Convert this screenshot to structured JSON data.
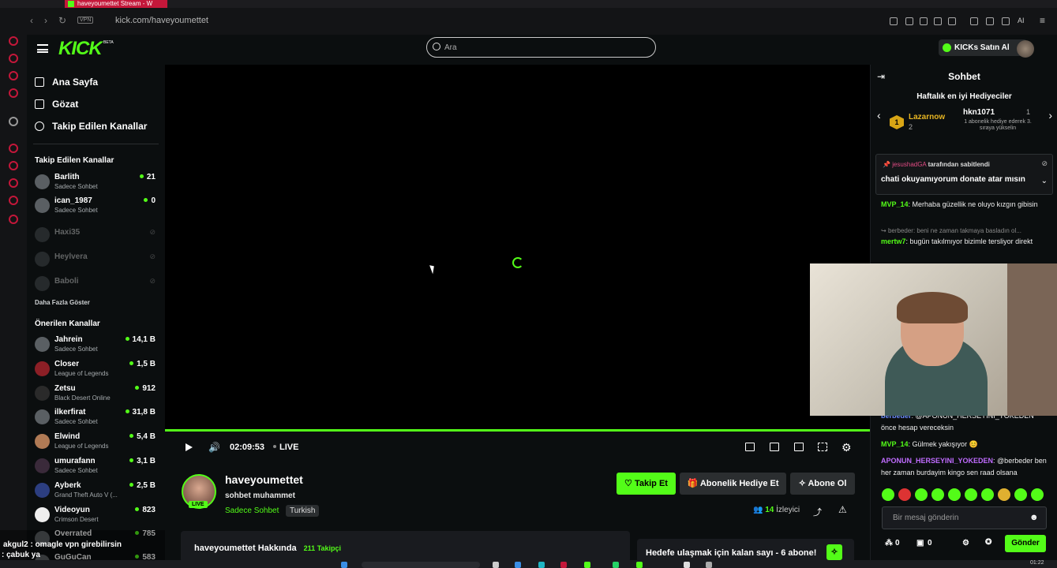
{
  "browser": {
    "tab_title": "haveyoumettet Stream - W",
    "url": "kick.com/haveyoumettet",
    "vpn_label": "VPN",
    "ai_label": "AI"
  },
  "header": {
    "logo": "KICK",
    "logo_beta": "BETA",
    "search_placeholder": "Ara",
    "buy_kicks": "KICKs Satın Al"
  },
  "sidebar": {
    "nav": [
      {
        "label": "Ana Sayfa",
        "icon": "home-icon"
      },
      {
        "label": "Gözat",
        "icon": "browse-icon"
      },
      {
        "label": "Takip Edilen Kanallar",
        "icon": "heart-icon"
      }
    ],
    "followed_title": "Takip Edilen Kanallar",
    "followed": [
      {
        "name": "Barlith",
        "sub": "Sadece Sohbet",
        "count": "21",
        "live": true
      },
      {
        "name": "ican_1987",
        "sub": "Sadece Sohbet",
        "count": "0",
        "live": true
      },
      {
        "name": "Haxi35",
        "sub": "",
        "count": "",
        "live": false
      },
      {
        "name": "Heylvera",
        "sub": "",
        "count": "",
        "live": false
      },
      {
        "name": "Baboli",
        "sub": "",
        "count": "",
        "live": false
      }
    ],
    "show_more": "Daha Fazla Göster",
    "recommended_title": "Önerilen Kanallar",
    "recommended": [
      {
        "name": "Jahrein",
        "sub": "Sadece Sohbet",
        "count": "14,1 B"
      },
      {
        "name": "Closer",
        "sub": "League of Legends",
        "count": "1,5 B"
      },
      {
        "name": "Zetsu",
        "sub": "Black Desert Online",
        "count": "912"
      },
      {
        "name": "ilkerfirat",
        "sub": "Sadece Sohbet",
        "count": "31,8 B"
      },
      {
        "name": "Elwind",
        "sub": "League of Legends",
        "count": "5,4 B"
      },
      {
        "name": "umurafann",
        "sub": "Sadece Sohbet",
        "count": "3,1 B"
      },
      {
        "name": "Ayberk",
        "sub": "Grand Theft Auto V (...",
        "count": "2,5 B"
      },
      {
        "name": "Videoyun",
        "sub": "Crimson Desert",
        "count": "823"
      },
      {
        "name": "Overrated",
        "sub": "",
        "count": "785"
      },
      {
        "name": "GuGuCan",
        "sub": "",
        "count": "583"
      }
    ],
    "overlay_line1": "akgul2 : omagle vpn girebilirsin",
    "overlay_line2": ": çabuk ya"
  },
  "player": {
    "time": "02:09:53",
    "live": "LIVE",
    "progress_fraction": 1.0
  },
  "stream": {
    "streamer": "haveyoumettet",
    "live_badge": "LIVE",
    "title": "sohbet muhammet",
    "category": "Sadece Sohbet",
    "language": "Turkish",
    "follow": "Takip Et",
    "gift_sub": "Abonelik Hediye Et",
    "subscribe": "Abone Ol",
    "viewers_count": "14",
    "viewers_label": "İzleyici",
    "about": "haveyoumettet Hakkında",
    "followers": "211 Takipçi",
    "goal": "Hedefe ulaşmak için kalan sayı - 6 abone!"
  },
  "chat": {
    "title": "Sohbet",
    "gifters_title": "Haftalık en iyi Hediyeciler",
    "gifter1_name": "Lazarnow",
    "gifter1_count": "2",
    "gifter1_rank": "1",
    "gifter2_name": "hkn1071",
    "gifter2_count": "1",
    "gifter2_sub": "1 abonelik hediye ederek 3. sıraya yükselin",
    "pinned_by_user": "jesushadGA",
    "pinned_by_suffix": "tarafından sabitlendi",
    "pinned_text": "chati okuyamıyorum donate atar mısın",
    "messages": [
      {
        "user": "MVP_14",
        "text": "Merhaba güzellik ne oluyo kızgın gibisin",
        "color": "#53fc18"
      },
      {
        "reply": "berbeder: beni ne zaman takmaya basladın ol..."
      },
      {
        "user": "mertw7",
        "text": "bugün takılmıyor bizimle tersliyor direkt",
        "color": "#53fc18"
      },
      {
        "user": "berbeder",
        "text": "@APONUN_HERSEYINI_YOKEDEN önce hesap vereceksin",
        "color": "#6c8cff"
      },
      {
        "user": "MVP_14",
        "text": "Gülmek yakışıyor 😊",
        "color": "#53fc18"
      },
      {
        "user": "APONUN_HERSEYINI_YOKEDEN",
        "text": "@berbeder ben her zaman burdayim kingo sen raad olsana",
        "color": "#c06cff"
      }
    ],
    "input_placeholder": "Bir mesaj gönderin",
    "kicks_balance": "0",
    "gift_balance": "0",
    "send": "Gönder"
  },
  "taskbar": {
    "clock": "01:22"
  }
}
